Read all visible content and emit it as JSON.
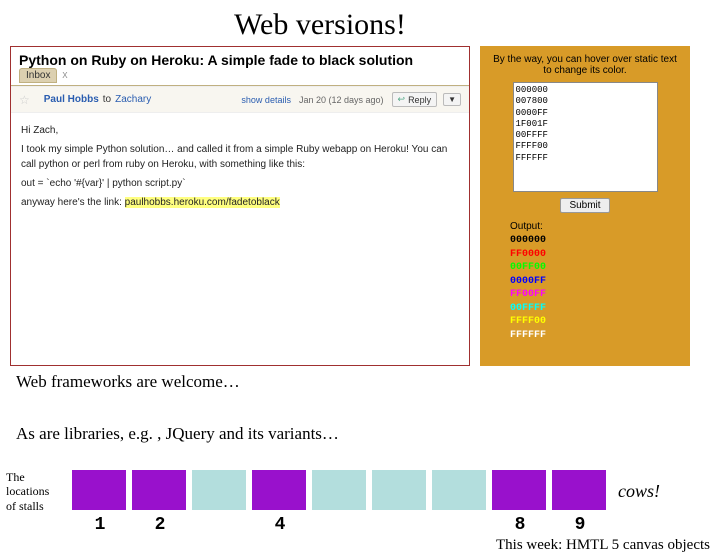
{
  "title": "Web versions!",
  "email": {
    "subject": "Python on Ruby on Heroku: A simple fade to black solution",
    "tab": "Inbox",
    "tabX": "X",
    "sender": "Paul Hobbs",
    "to_label": "to",
    "recipient": "Zachary",
    "details": "show details",
    "date": "Jan 20 (12 days ago)",
    "reply": "Reply",
    "dropdown": "▼",
    "greeting": "Hi Zach,",
    "para1": "I took my simple Python solution… and called it from a simple Ruby webapp on Heroku!  You can call python or perl from ruby on Heroku, with something like this:",
    "code": "out = `echo '#{var}' | python script.py`",
    "para2a": "anyway here's the link: ",
    "link": "paulhobbs.heroku.com/fadetoblack"
  },
  "panel": {
    "hint": "By the way, you can hover over static text to change its color.",
    "list": [
      "000000",
      "007800",
      "0000FF",
      "1F001F",
      "00FFFF",
      "FFFF00",
      "FFFFFF"
    ],
    "submit": "Submit",
    "output_label": "Output:",
    "outputs": [
      {
        "text": "000000",
        "color": "#000000"
      },
      {
        "text": "FF0000",
        "color": "#ff0000"
      },
      {
        "text": "00FF00",
        "color": "#00ff00"
      },
      {
        "text": "0000FF",
        "color": "#0000ff"
      },
      {
        "text": "FF00FF",
        "color": "#ff00ff"
      },
      {
        "text": "00FFFF",
        "color": "#00ffff"
      },
      {
        "text": "FFFF00",
        "color": "#ffff00"
      },
      {
        "text": "FFFFFF",
        "color": "#ffffff"
      }
    ]
  },
  "line1": "Web frameworks are welcome…",
  "line2": "As are libraries, e.g. , JQuery and its variants…",
  "stalls_label_a": "The",
  "stalls_label_b": "locations",
  "stalls_label_c": "of stalls",
  "cows": "cows!",
  "nums": {
    "n1": "1",
    "n2": "2",
    "n4": "4",
    "n8": "8",
    "n9": "9"
  },
  "footnote": "This week: HMTL 5 canvas objects"
}
